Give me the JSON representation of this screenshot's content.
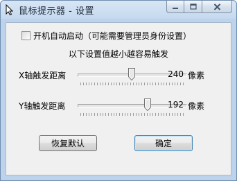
{
  "window": {
    "title": "鼠标提示器 - 设置"
  },
  "options": {
    "autostart_label": "开机自动启动（可能需要管理员身份设置）",
    "autostart_checked": false
  },
  "hint": "以下设置值越小越容易触发",
  "sliders": [
    {
      "label": "X轴触发距离",
      "value": "240",
      "unit": "像素",
      "fraction": 0.5
    },
    {
      "label": "Y轴触发距离",
      "value": "192",
      "unit": "像素",
      "fraction": 0.66
    }
  ],
  "buttons": {
    "reset": "恢复默认",
    "ok": "确定"
  }
}
